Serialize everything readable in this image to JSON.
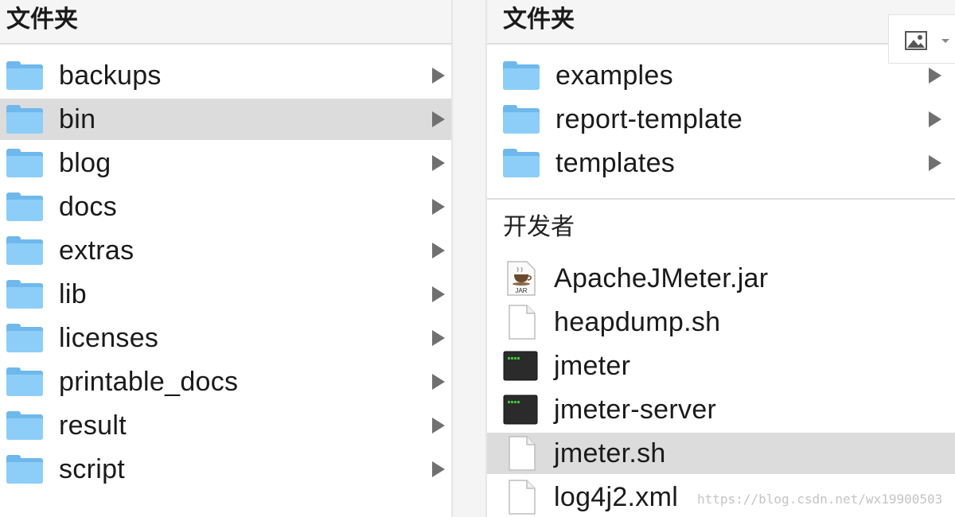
{
  "left_column": {
    "header": "文件夹",
    "items": [
      {
        "label": "backups",
        "type": "folder",
        "selected": false
      },
      {
        "label": "bin",
        "type": "folder",
        "selected": true
      },
      {
        "label": "blog",
        "type": "folder",
        "selected": false
      },
      {
        "label": "docs",
        "type": "folder",
        "selected": false
      },
      {
        "label": "extras",
        "type": "folder",
        "selected": false
      },
      {
        "label": "lib",
        "type": "folder",
        "selected": false
      },
      {
        "label": "licenses",
        "type": "folder",
        "selected": false
      },
      {
        "label": "printable_docs",
        "type": "folder",
        "selected": false
      },
      {
        "label": "result",
        "type": "folder",
        "selected": false
      },
      {
        "label": "script",
        "type": "folder",
        "selected": false
      }
    ]
  },
  "right_column": {
    "header": "文件夹",
    "folders": [
      {
        "label": "examples",
        "type": "folder",
        "selected": false
      },
      {
        "label": "report-template",
        "type": "folder",
        "selected": false
      },
      {
        "label": "templates",
        "type": "folder",
        "selected": false
      }
    ],
    "section_label": "开发者",
    "files": [
      {
        "label": "ApacheJMeter.jar",
        "icon": "jar-file-icon",
        "selected": false
      },
      {
        "label": "heapdump.sh",
        "icon": "document-icon",
        "selected": false
      },
      {
        "label": "jmeter",
        "icon": "terminal-exec-icon",
        "selected": false
      },
      {
        "label": "jmeter-server",
        "icon": "terminal-exec-icon",
        "selected": false
      },
      {
        "label": "jmeter.sh",
        "icon": "document-icon",
        "selected": true
      },
      {
        "label": "log4j2.xml",
        "icon": "document-icon",
        "selected": false
      }
    ]
  },
  "toolbar": {
    "image_button_icon": "image-icon"
  },
  "jar_badge": "JAR",
  "watermark": "https://blog.csdn.net/wx19900503",
  "colors": {
    "folder": "#8dcef9",
    "selection": "#dcdcdc",
    "header_bg": "#f5f5f5"
  }
}
